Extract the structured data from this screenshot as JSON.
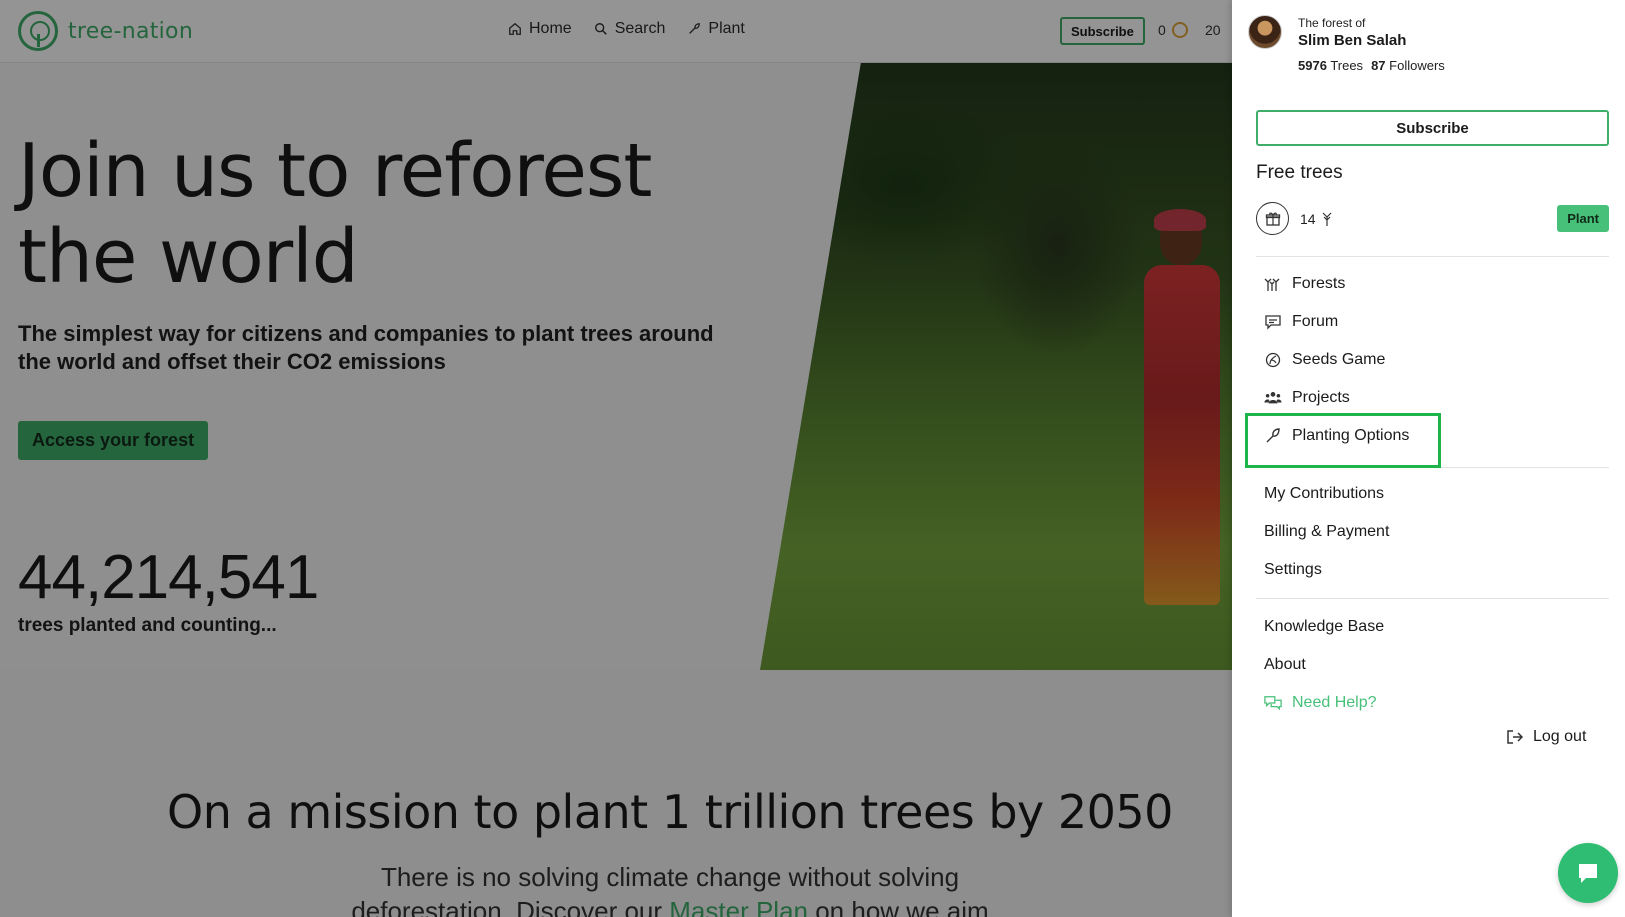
{
  "brand": {
    "name": "tree-nation"
  },
  "topnav": [
    {
      "label": "Home",
      "icon": "home-icon"
    },
    {
      "label": "Search",
      "icon": "search-icon"
    },
    {
      "label": "Plant",
      "icon": "plant-icon"
    }
  ],
  "topbar": {
    "subscribe_label": "Subscribe",
    "coins": "0",
    "trees": "20"
  },
  "hero": {
    "title": "Join us to reforest the world",
    "subtitle": "The simplest way for citizens and companies to plant trees around the world and offset their CO2 emissions",
    "cta_label": "Access your forest",
    "counter": "44,214,541",
    "counter_label": "trees planted and counting..."
  },
  "mission": {
    "title": "On a mission to plant 1 trillion trees by 2050",
    "text_before": "There is no solving climate change without solving deforestation. Discover our ",
    "link_text": "Master Plan",
    "text_after": " on how we aim to"
  },
  "panel": {
    "forest_of": "The forest of",
    "user_name": "Slim Ben Salah",
    "trees_count": "5976",
    "trees_label": "Trees",
    "followers_count": "87",
    "followers_label": "Followers",
    "subscribe_label": "Subscribe",
    "free_trees_title": "Free trees",
    "free_trees_count": "14",
    "plant_label": "Plant",
    "menu_primary": [
      {
        "label": "Forests",
        "icon": "forest-icon"
      },
      {
        "label": "Forum",
        "icon": "forum-icon"
      },
      {
        "label": "Seeds Game",
        "icon": "seed-icon"
      },
      {
        "label": "Projects",
        "icon": "people-icon"
      },
      {
        "label": "Planting Options",
        "icon": "planting-icon"
      }
    ],
    "menu_account": [
      {
        "label": "My Contributions"
      },
      {
        "label": "Billing & Payment"
      },
      {
        "label": "Settings"
      }
    ],
    "menu_info": [
      {
        "label": "Knowledge Base"
      },
      {
        "label": "About"
      },
      {
        "label": "Need Help?",
        "icon": "help-chat-icon"
      }
    ],
    "logout_label": "Log out"
  },
  "colors": {
    "accent": "#3fae6a",
    "plant_button": "#47c07a",
    "highlight": "#1fb34c",
    "chat": "#2ebd72"
  }
}
